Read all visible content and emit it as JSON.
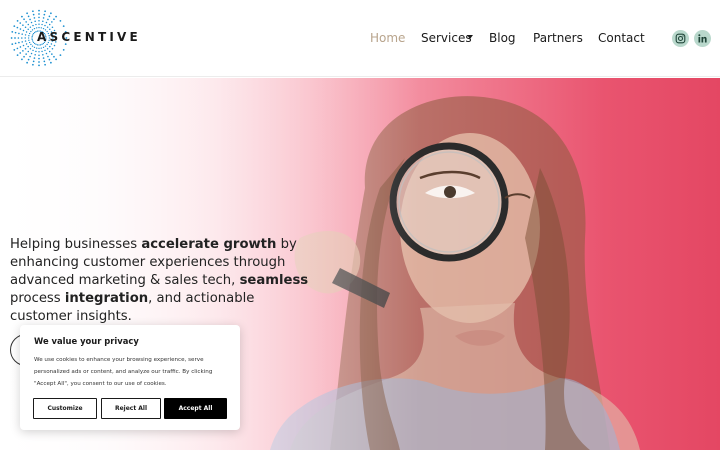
{
  "header": {
    "logo_text": "ASCENTIVE",
    "logo_color": "#1a8fd0",
    "nav": {
      "home": "Home",
      "services": "Services",
      "blog": "Blog",
      "partners": "Partners",
      "contact": "Contact"
    },
    "active_color": "#b8a48c",
    "social_icons": [
      "instagram-icon",
      "linkedin-icon"
    ],
    "social_bg": "#b9d8cc"
  },
  "hero": {
    "t1": "Helping businesses ",
    "b1": "accelerate growth",
    "t2": " by enhancing customer experiences through advanced marketing & sales tech, ",
    "b2": "seamless",
    "t3": " process ",
    "b3": "integration",
    "t4": ", and actionable customer insights.",
    "accent": "#e44763"
  },
  "cookie": {
    "title": "We value your privacy",
    "body": "We use cookies to enhance your browsing experience, serve personalized ads or content, and analyze our traffic. By clicking \"Accept All\", you consent to our use of cookies.",
    "customize": "Customize",
    "reject": "Reject All",
    "accept": "Accept All"
  }
}
